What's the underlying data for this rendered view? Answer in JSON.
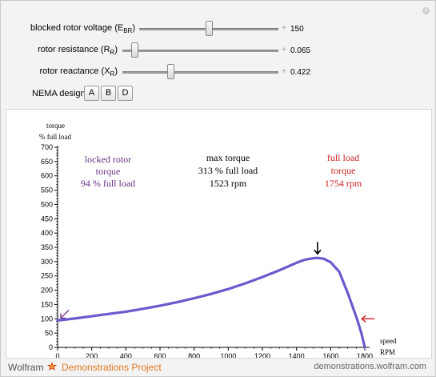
{
  "controls": [
    {
      "label": "blocked rotor voltage (E",
      "sub": "BR",
      "close": ")",
      "value": "150",
      "fraction": 0.5
    },
    {
      "label": "rotor resistance (R",
      "sub": "R",
      "close": ")",
      "value": "0.065",
      "fraction": 0.06
    },
    {
      "label": "rotor reactance (X",
      "sub": "R",
      "close": ")",
      "value": "0.422",
      "fraction": 0.3
    }
  ],
  "nema": {
    "label": "NEMA design",
    "options": [
      "A",
      "B",
      "D"
    ]
  },
  "chart_data": {
    "type": "line",
    "ylabel": [
      "torque",
      "% full load"
    ],
    "xlabel": [
      "speed",
      "RPM"
    ],
    "xlim": [
      0,
      1800
    ],
    "ylim": [
      0,
      700
    ],
    "xticks": [
      "0",
      "200",
      "400",
      "600",
      "800",
      "1000",
      "1200",
      "1400",
      "1600",
      "1800"
    ],
    "yticks": [
      "0",
      "50",
      "100",
      "150",
      "200",
      "250",
      "300",
      "350",
      "400",
      "450",
      "500",
      "550",
      "600",
      "650",
      "700"
    ],
    "series": [
      {
        "color": "#6a5acd",
        "x": [
          0,
          100,
          200,
          300,
          400,
          500,
          600,
          700,
          800,
          900,
          1000,
          1100,
          1200,
          1300,
          1400,
          1450,
          1500,
          1523,
          1560,
          1600,
          1650,
          1700,
          1754,
          1780,
          1800
        ],
        "y": [
          94,
          101,
          109,
          117,
          125,
          135,
          146,
          158,
          172,
          187,
          204,
          224,
          246,
          270,
          296,
          307,
          312,
          313,
          310,
          298,
          265,
          190,
          100,
          50,
          0
        ]
      }
    ],
    "annotations": {
      "locked_rotor": [
        "locked rotor",
        "torque",
        "94 % full load"
      ],
      "max_torque": [
        "max torque",
        "313 % full load",
        "1523 rpm"
      ],
      "full_load": [
        "full load",
        "torque",
        "1754 rpm"
      ]
    },
    "markers": {
      "locked_rotor": {
        "x": 0,
        "y": 94,
        "color": "#7a3a8c"
      },
      "max_torque": {
        "x": 1523,
        "y": 313,
        "color": "#000000"
      },
      "full_load": {
        "x": 1754,
        "y": 100,
        "color": "#cc2222"
      }
    }
  },
  "colors": {
    "locked": "#6b2f83",
    "max": "#000000",
    "full": "#cc2222",
    "curve": "#6a5acd"
  },
  "footer": {
    "wolfram": "Wolfram",
    "demos": "Demonstrations Project",
    "site": "demonstrations.wolfram.com"
  }
}
